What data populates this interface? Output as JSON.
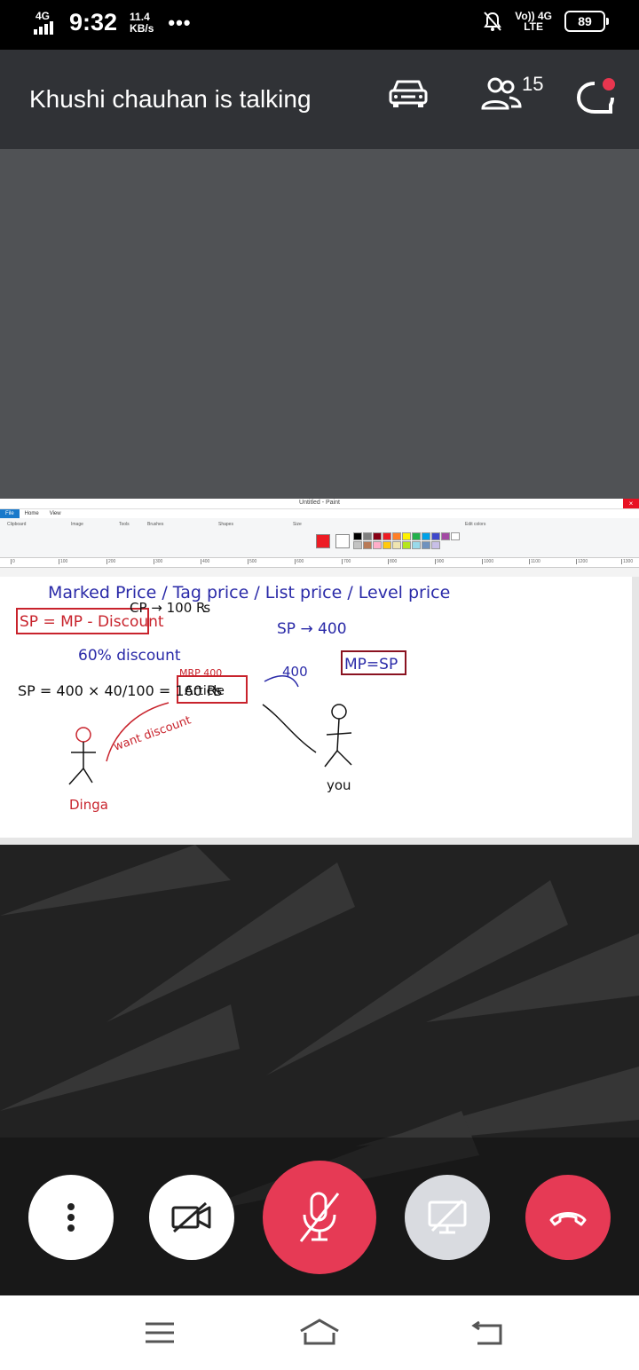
{
  "status": {
    "network": "4G",
    "time": "9:32",
    "speed_value": "11.4",
    "speed_unit": "KB/s",
    "more": "•••",
    "volte_top": "Vo)) 4G",
    "volte_bottom": "LTE",
    "battery": "89"
  },
  "call": {
    "title": "Khushi chauhan is talking",
    "participants_count": "15",
    "icons": [
      "car-mode-icon",
      "participants-icon",
      "chat-icon"
    ]
  },
  "paint": {
    "window_title": "Untitled - Paint",
    "menu": [
      "File",
      "Home",
      "View"
    ],
    "ribbon_groups": [
      "Clipboard",
      "Image",
      "Tools",
      "Brushes",
      "Shapes",
      "Size",
      "Color 1",
      "Color 2",
      "Colors",
      "Edit colors"
    ],
    "ruler": [
      "0",
      "100",
      "200",
      "300",
      "400",
      "500",
      "600",
      "700",
      "800",
      "900",
      "1000",
      "1100",
      "1200",
      "1300"
    ],
    "notes": {
      "line1": "Marked Price / Tag price / List price / Level price",
      "formula": "SP = MP - Discount",
      "cp": "CP → 100 ₨",
      "sp400": "SP → 400",
      "discount": "60% discount",
      "mpsp": "MP=SP",
      "mrp": "MRP 400",
      "article": "Article",
      "sp_calc": "SP = 400 × 40/100 = 160 ₨",
      "n400": "400",
      "want": "want discount",
      "dinga": "Dinga",
      "you": "you"
    },
    "palette": [
      "#000000",
      "#7f7f7f",
      "#880015",
      "#ed1c24",
      "#ff7f27",
      "#fff200",
      "#22b14c",
      "#00a2e8",
      "#3f48cc",
      "#a349a4",
      "#ffffff",
      "#c3c3c3",
      "#b97a57",
      "#ffaec9",
      "#ffc90e",
      "#efe4b0",
      "#b5e61d",
      "#99d9ea",
      "#7092be",
      "#c8bfe7"
    ]
  },
  "controls": [
    "more-options-button",
    "video-off-button",
    "mic-mute-button",
    "screen-share-button",
    "end-call-button"
  ]
}
